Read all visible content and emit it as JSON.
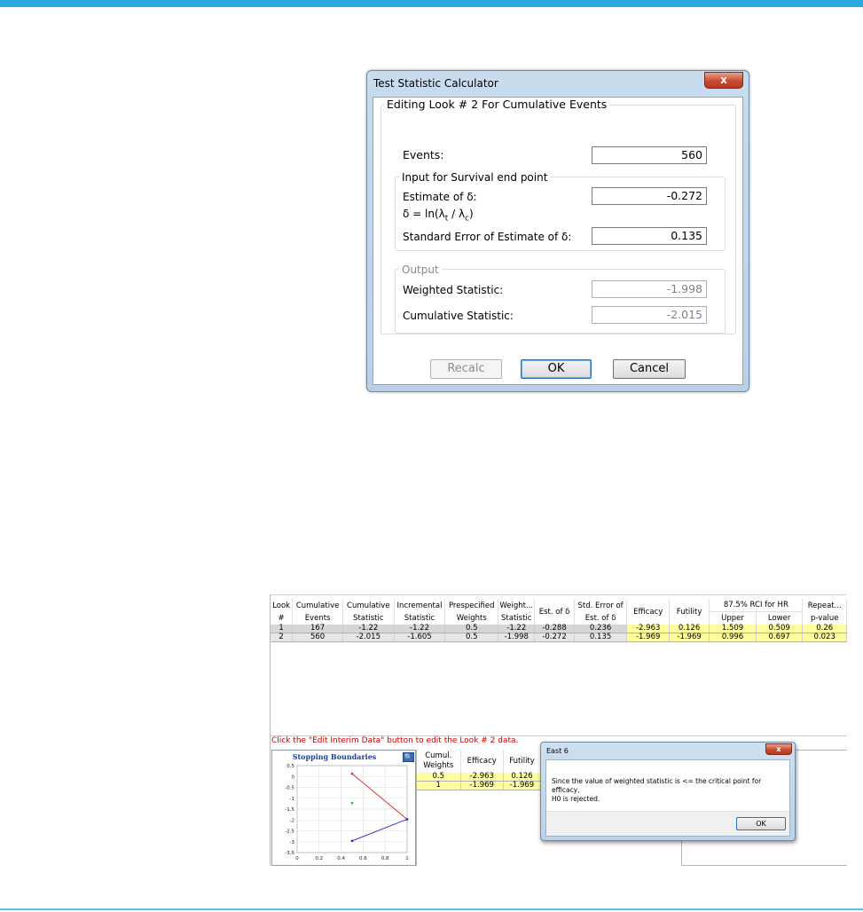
{
  "calculator": {
    "title": "Test Statistic Calculator",
    "close_glyph": "x",
    "group_title": "Editing Look # 2 For Cumulative Events",
    "events_label": "Events:",
    "events_value": "560",
    "survival_group_title": "Input for Survival end point",
    "estimate_label": "Estimate of δ:",
    "estimate_value": "-0.272",
    "delta_formula_prefix": "δ = ln(λ",
    "delta_formula_sub_t": "t",
    "delta_formula_mid": " / λ",
    "delta_formula_sub_c": "c",
    "delta_formula_suffix": ")",
    "se_label": "Standard Error of Estimate of δ:",
    "se_value": "0.135",
    "output_group_title": "Output",
    "weighted_label": "Weighted Statistic:",
    "weighted_value": "-1.998",
    "cumulative_label": "Cumulative Statistic:",
    "cumulative_value": "-2.015",
    "recalc_label": "Recalc",
    "ok_label": "OK",
    "cancel_label": "Cancel"
  },
  "results_table": {
    "headers": {
      "look": [
        "Look",
        "#"
      ],
      "cum_events": [
        "Cumulative",
        "Events"
      ],
      "cum_stat": [
        "Cumulative",
        "Statistic"
      ],
      "inc_stat": [
        "Incremental",
        "Statistic"
      ],
      "pre_weights": [
        "Prespecified",
        "Weights"
      ],
      "weight_stat": [
        "Weight...",
        "Statistic"
      ],
      "est_delta": "Est. of δ",
      "std_err": [
        "Std. Error of",
        "Est. of δ"
      ],
      "efficacy": "Efficacy",
      "futility": "Futility",
      "rci_group": "87.5% RCI for HR",
      "upper": "Upper",
      "lower": "Lower",
      "repeat": [
        "Repeat...",
        "p-value"
      ]
    },
    "rows": [
      [
        "1",
        "167",
        "-1.22",
        "-1.22",
        "0.5",
        "-1.22",
        "-0.288",
        "0.236",
        "-2.963",
        "0.126",
        "1.509",
        "0.509",
        "0.26"
      ],
      [
        "2",
        "560",
        "-2.015",
        "-1.605",
        "0.5",
        "-1.998",
        "-0.272",
        "0.135",
        "-1.969",
        "-1.969",
        "0.996",
        "0.697",
        "0.023"
      ]
    ],
    "hint": "Click the \"Edit Interim Data\" button to edit the Look # 2 data."
  },
  "boundaries_panel": {
    "title": "Stopping Boundaries",
    "zoom_icon": "magnifier-icon",
    "zoom_glyph": "🔍",
    "headers": {
      "cumul": [
        "Cumul.",
        "Weights"
      ],
      "efficacy": "Efficacy",
      "futility": "Futility"
    },
    "rows": [
      [
        "0.5",
        "-2.963",
        "0.126"
      ],
      [
        "1",
        "-1.969",
        "-1.969"
      ]
    ]
  },
  "chart_data": {
    "type": "line",
    "title": "Stopping Boundaries",
    "xlabel": "",
    "ylabel": "",
    "xlim": [
      0,
      1
    ],
    "ylim": [
      -3.5,
      0.5
    ],
    "x_ticks": [
      "0",
      "0.2",
      "0.4",
      "0.6",
      "0.8",
      "1"
    ],
    "y_ticks": [
      "0.5",
      "0",
      "-0.5",
      "-1",
      "-1.5",
      "-2",
      "-2.5",
      "-3",
      "-3.5"
    ],
    "grid": true,
    "series": [
      {
        "color": "#e02020",
        "points": [
          [
            0.5,
            0.126
          ],
          [
            1,
            -1.969
          ]
        ]
      },
      {
        "color": "#2020d0",
        "points": [
          [
            0.5,
            -2.963
          ],
          [
            1,
            -1.969
          ]
        ]
      },
      {
        "color": "#20b020",
        "points": [
          [
            0.5,
            -1.22
          ]
        ]
      }
    ]
  },
  "message_box": {
    "title": "East 6",
    "close_glyph": "x",
    "text_line1": "Since the value of weighted statistic is <= the critical point for efficacy,",
    "text_line2": "H0 is rejected.",
    "ok_label": "OK"
  }
}
